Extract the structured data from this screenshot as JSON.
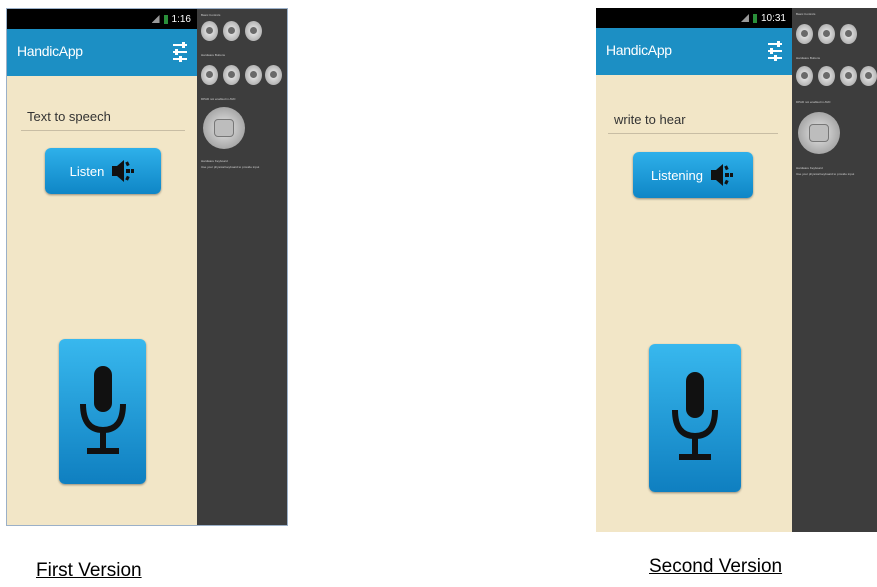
{
  "first": {
    "status_time": "1:16",
    "app_title": "HandicApp",
    "text_field": "Text to speech",
    "listen_label": "Listen",
    "caption": "First Version",
    "controls": {
      "basic_label": "Basic Controls",
      "hardware_label": "Hardware Buttons",
      "dpad_label": "DPAD not enabled in AVD",
      "keyboard_label": "Hardware Keyboard",
      "keyboard_note": "Use your physical keyboard to provide input"
    }
  },
  "second": {
    "status_time": "10:31",
    "app_title": "HandicApp",
    "text_field": "write to hear",
    "listen_label": "Listening",
    "caption": "Second Version",
    "controls": {
      "basic_label": "Basic Controls",
      "hardware_label": "Hardware Buttons",
      "dpad_label": "DPAD not enabled in AVD",
      "keyboard_label": "Hardware Keyboard",
      "keyboard_note": "Use your physical keyboard to provide input"
    }
  },
  "colors": {
    "action_bar": "#1c8fc4",
    "app_background": "#f2e6c7",
    "button_blue": "#1a9ad8",
    "controls_panel": "#3d3d3d"
  },
  "icons": [
    "settings-sliders-icon",
    "speaker-icon",
    "microphone-icon",
    "signal-icon",
    "battery-icon"
  ]
}
